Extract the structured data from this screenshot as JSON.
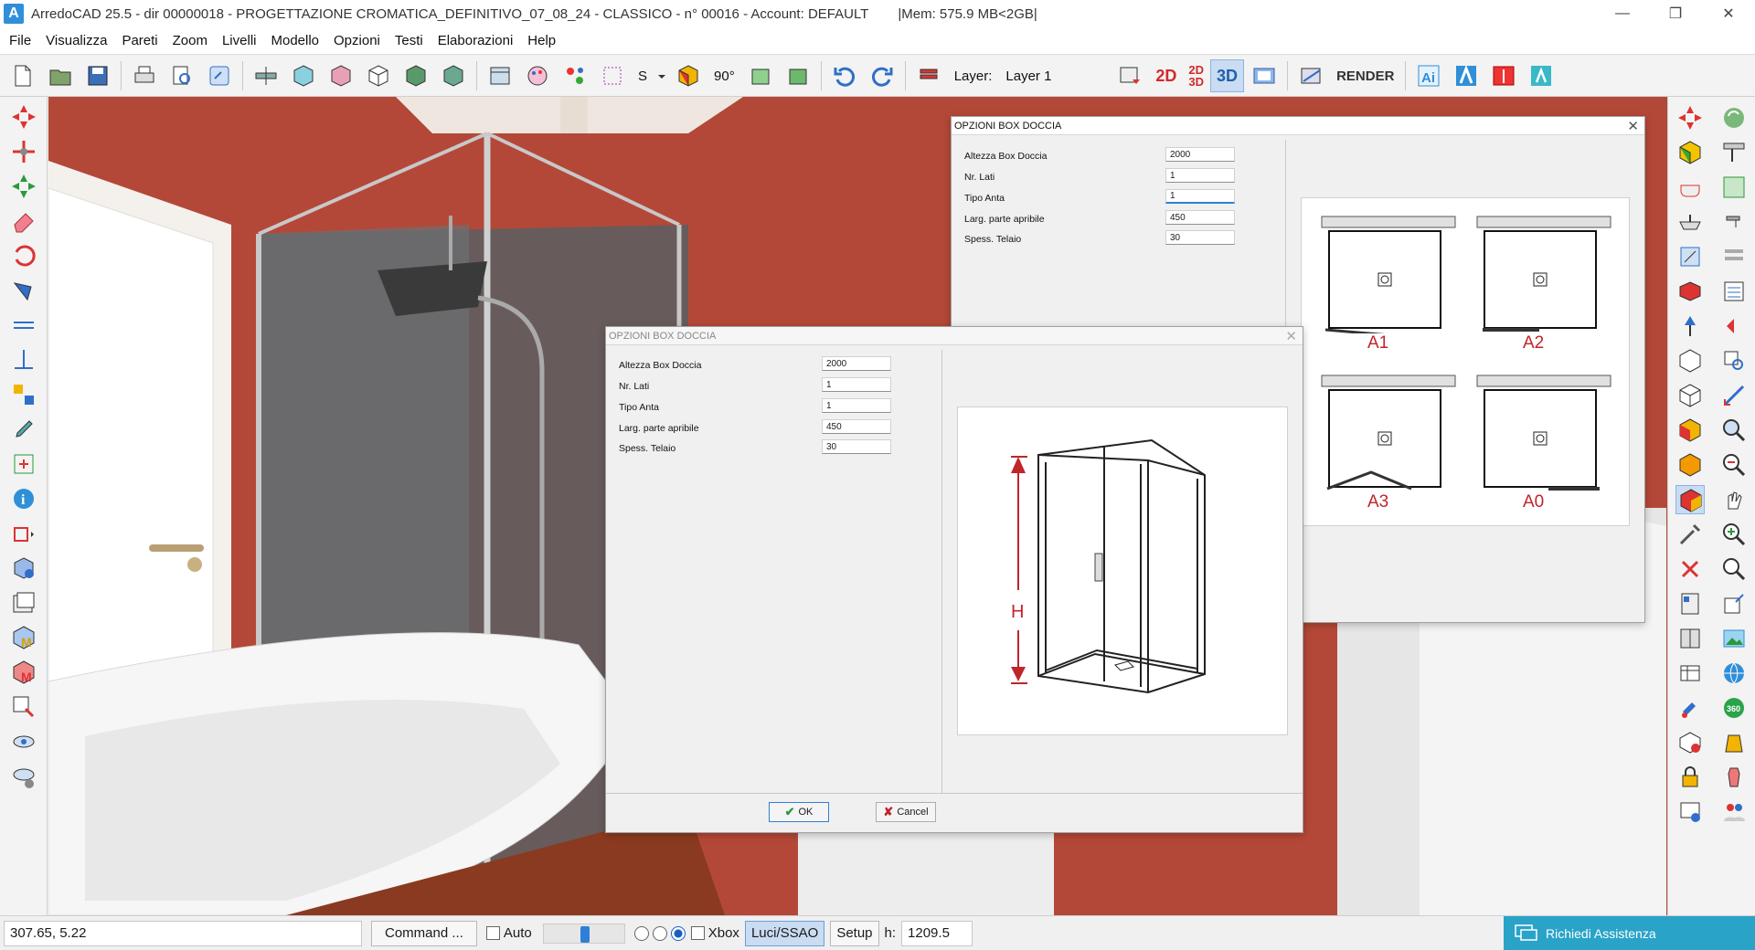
{
  "window": {
    "logo": "A",
    "title": "ArredoCAD 25.5 - dir 00000018 - PROGETTAZIONE CROMATICA_DEFINITIVO_07_08_24 - CLASSICO - n° 00016 - Account: DEFAULT",
    "mem": "|Mem: 575.9 MB<2GB|",
    "controls": [
      "—",
      "❐",
      "✕"
    ]
  },
  "menu": [
    "File",
    "Visualizza",
    "Pareti",
    "Zoom",
    "Livelli",
    "Modello",
    "Opzioni",
    "Testi",
    "Elaborazioni",
    "Help"
  ],
  "toolbar": {
    "s_label": "S",
    "angle_label": "90°",
    "layer_label": "Layer:",
    "layer_value": "Layer 1",
    "view_2d": "2D",
    "view_2d3d_top": "2D",
    "view_2d3d_bottom": "3D",
    "view_3d": "3D",
    "render_label": "RENDER"
  },
  "dialog_back": {
    "title": "OPZIONI BOX DOCCIA",
    "fields": [
      {
        "label": "Altezza Box Doccia",
        "value": "2000"
      },
      {
        "label": "Nr. Lati",
        "value": "1"
      },
      {
        "label": "Tipo Anta",
        "value": "1"
      },
      {
        "label": "Larg. parte apribile",
        "value": "450"
      },
      {
        "label": "Spess. Telaio",
        "value": "30"
      }
    ],
    "options": [
      "A1",
      "A2",
      "A3",
      "A0"
    ]
  },
  "dialog_front": {
    "title": "OPZIONI BOX DOCCIA",
    "fields": [
      {
        "label": "Altezza Box Doccia",
        "value": "2000"
      },
      {
        "label": "Nr. Lati",
        "value": "1"
      },
      {
        "label": "Tipo Anta",
        "value": "1"
      },
      {
        "label": "Larg. parte apribile",
        "value": "450"
      },
      {
        "label": "Spess. Telaio",
        "value": "30"
      }
    ],
    "diagram_label": "H",
    "ok_label": "OK",
    "cancel_label": "Cancel"
  },
  "status": {
    "coords": "307.65, 5.22",
    "command_label": "Command ...",
    "auto_label": "Auto",
    "xbox_label": "Xbox",
    "luci_label": "Luci/SSAO",
    "setup_label": "Setup",
    "h_label": "h:",
    "h_value": "1209.5",
    "assist_label": "Richiedi Assistenza"
  },
  "colors": {
    "accent_red": "#c0252b",
    "assist_bg": "#2aa3c8",
    "wall": "#b64a3c",
    "active_view": "#c9dcf2"
  }
}
